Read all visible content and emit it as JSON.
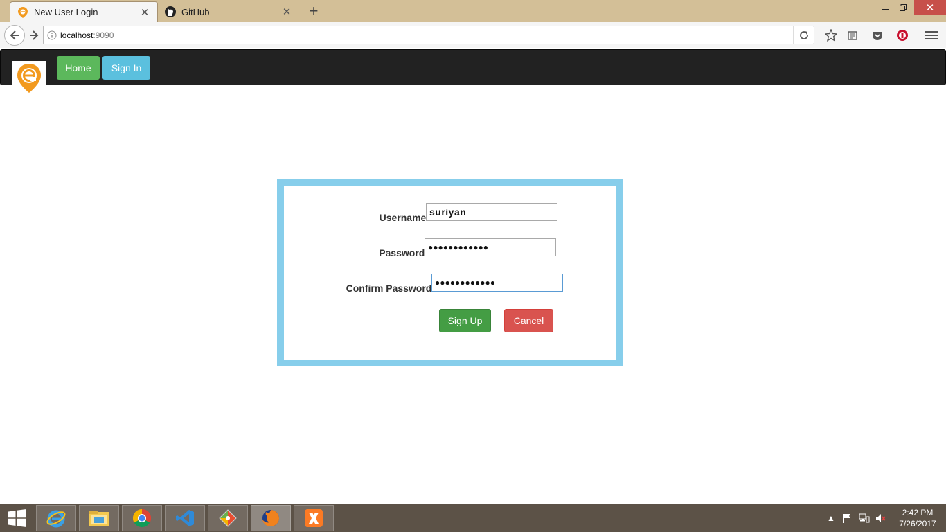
{
  "browser": {
    "tabs": [
      {
        "label": "New User Login",
        "icon": "site-logo-icon",
        "active": true
      },
      {
        "label": "GitHub",
        "icon": "github-icon",
        "active": false
      }
    ],
    "url_host": "localhost",
    "url_port": ":9090"
  },
  "header": {
    "nav": {
      "home": "Home",
      "sign_in": "Sign In"
    }
  },
  "form": {
    "username_label": "Username:",
    "username_value": "suriyan",
    "password_label": "Password:",
    "password_value": "●●●●●●●●●●●●",
    "confirm_label": "Confirm Password:",
    "confirm_value": "●●●●●●●●●●●●",
    "signup_label": "Sign Up",
    "cancel_label": "Cancel"
  },
  "taskbar": {
    "apps": [
      "internet-explorer-icon",
      "file-explorer-icon",
      "chrome-icon",
      "visual-studio-icon",
      "git-icon",
      "firefox-icon",
      "xampp-icon"
    ],
    "time": "2:42 PM",
    "date": "7/26/2017"
  },
  "colors": {
    "navbar": "#222222",
    "home_button": "#5cb85c",
    "signin_button": "#5bc0de",
    "form_border": "#87ceeb",
    "signup_button": "#449d44",
    "cancel_button": "#d9534f"
  }
}
